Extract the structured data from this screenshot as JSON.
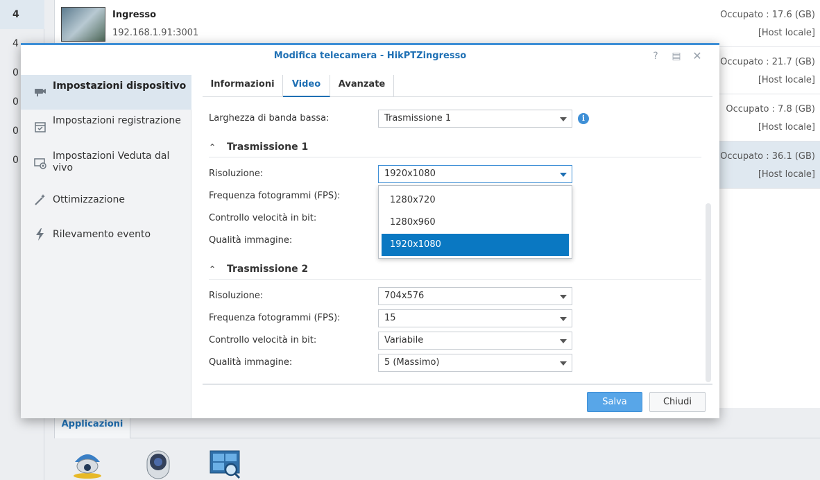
{
  "background": {
    "left_counts": [
      "4",
      "4",
      "0",
      "0",
      "0",
      "0"
    ],
    "cameras": [
      {
        "name": "Ingresso",
        "address": "192.168.1.91:3001",
        "used": "Occupato : 17.6 (GB)",
        "host": "[Host locale]"
      },
      {
        "name": "",
        "address": "",
        "used": "Occupato : 21.7 (GB)",
        "host": "[Host locale]"
      },
      {
        "name": "",
        "address": "",
        "used": "Occupato : 7.8 (GB)",
        "host": "[Host locale]"
      },
      {
        "name": "",
        "address": "",
        "used": "Occupato : 36.1 (GB)",
        "host": "[Host locale]"
      }
    ],
    "bottom_tab": "Applicazioni",
    "app_icons": [
      "camera-dome-icon",
      "camera-fisheye-icon",
      "monitor-search-icon"
    ]
  },
  "dialog": {
    "title": "Modifica telecamera - HikPTZingresso",
    "titlebar_icons": [
      "help-icon",
      "maximize-icon",
      "close-icon"
    ],
    "sidebar": [
      {
        "label": "Impostazioni dispositivo",
        "icon": "camera-icon",
        "active": true
      },
      {
        "label": "Impostazioni registrazione",
        "icon": "calendar-icon",
        "active": false
      },
      {
        "label": "Impostazioni Veduta dal vivo",
        "icon": "monitor-camera-icon",
        "active": false
      },
      {
        "label": "Ottimizzazione",
        "icon": "magic-wand-icon",
        "active": false
      },
      {
        "label": "Rilevamento evento",
        "icon": "lightning-icon",
        "active": false
      }
    ],
    "tabs": [
      {
        "label": "Informazioni",
        "active": false
      },
      {
        "label": "Video",
        "active": true
      },
      {
        "label": "Avanzate",
        "active": false
      }
    ],
    "low_bandwidth": {
      "label": "Larghezza di banda bassa:",
      "value": "Trasmissione 1"
    },
    "stream1": {
      "title": "Trasmissione 1",
      "resolution": {
        "label": "Risoluzione:",
        "value": "1920x1080"
      },
      "fps_label": "Frequenza fotogrammi (FPS):",
      "bitrate_label": "Controllo velocità in bit:",
      "quality_label": "Qualità immagine:"
    },
    "resolution_options": [
      "1280x720",
      "1280x960",
      "1920x1080"
    ],
    "resolution_selected_index": 2,
    "stream2": {
      "title": "Trasmissione 2",
      "resolution": {
        "label": "Risoluzione:",
        "value": "704x576"
      },
      "fps": {
        "label": "Frequenza fotogrammi (FPS):",
        "value": "15"
      },
      "bitrate": {
        "label": "Controllo velocità in bit:",
        "value": "Variabile"
      },
      "quality": {
        "label": "Qualità immagine:",
        "value": "5 (Massimo)"
      }
    },
    "buttons": {
      "save": "Salva",
      "close": "Chiudi"
    },
    "colors": {
      "accent": "#1f70b4",
      "selected_item": "#0a78c2",
      "save_button": "#58a6e8"
    }
  }
}
